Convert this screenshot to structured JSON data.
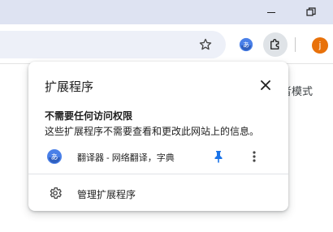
{
  "colors": {
    "titlebar": "#dee3f2",
    "omnibox": "#edf0f8",
    "pin_accent": "#1a73e8",
    "avatar_bg": "#e8710a"
  },
  "window": {
    "minimize_icon": "minimize-icon",
    "restore_icon": "restore-icon"
  },
  "toolbar": {
    "bookmark_icon": "star-icon",
    "translate_extension_icon": "translate-extension-icon",
    "extensions_icon": "puzzle-icon",
    "avatar_letter": "j"
  },
  "page": {
    "right_text": "者模式"
  },
  "popup": {
    "title": "扩展程序",
    "close_icon": "close-icon",
    "section_title": "不需要任何访问权限",
    "section_description": "这些扩展程序不需要查看和更改此网站上的信息。",
    "extension": {
      "name": "翻译器 - 网络翻译，字典",
      "icon_glyph": "あ",
      "pinned": true
    },
    "manage_label": "管理扩展程序"
  }
}
